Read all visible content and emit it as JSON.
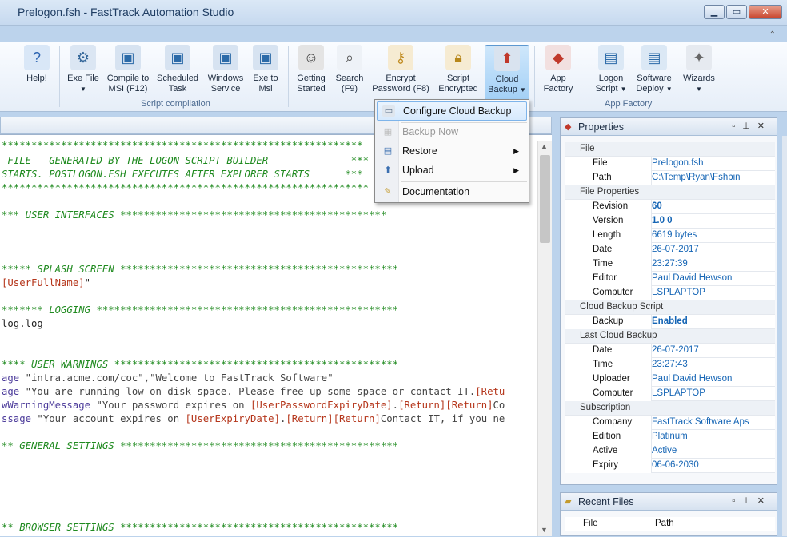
{
  "window": {
    "title": "Prelogon.fsh - FastTrack Automation Studio"
  },
  "ribbon": {
    "buttons": {
      "help": "Help!",
      "exe_file_1": "Exe File",
      "compile_msi_1": "Compile to",
      "compile_msi_2": "MSI (F12)",
      "scheduled_1": "Scheduled",
      "scheduled_2": "Task",
      "windows_1": "Windows",
      "windows_2": "Service",
      "exe_msi_1": "Exe to",
      "exe_msi_2": "Msi",
      "getting_1": "Getting",
      "getting_2": "Started",
      "search_1": "Search",
      "search_2": "(F9)",
      "encrypt_1": "Encrypt",
      "encrypt_2": "Password (F8)",
      "script_enc_1": "Script",
      "script_enc_2": "Encrypted",
      "cloud_1": "Cloud",
      "cloud_2": "Backup",
      "app_factory_1": "App",
      "app_factory_2": "Factory",
      "logon_1": "Logon",
      "logon_2": "Script",
      "software_1": "Software",
      "software_2": "Deploy",
      "wizards": "Wizards"
    },
    "groups": {
      "script_compilation": "Script compilation",
      "app_factory": "App Factory"
    }
  },
  "menu": {
    "configure": "Configure Cloud Backup",
    "backup_now": "Backup Now",
    "restore": "Restore",
    "upload": "Upload",
    "documentation": "Documentation"
  },
  "code": {
    "l1a": "*************************************************************",
    "l2": " FILE - GENERATED BY THE LOGON SCRIPT BUILDER              ***",
    "l3": "STARTS. POSTLOGON.FSH EXECUTES AFTER EXPLORER STARTS      ***",
    "l4": "**************************************************************",
    "l5": "*** USER INTERFACES *********************************************",
    "l6a": "***** SPLASH SCREEN ***********************************************",
    "l7a": "[UserFullName]",
    "l7b": "\"",
    "l8": "******* LOGGING ***************************************************",
    "l9": "log.log",
    "l10": "**** USER WARNINGS ************************************************",
    "l11a": "age ",
    "l11b": "\"intra.acme.com/coc\",\"Welcome to FastTrack Software\"",
    "l12a": "age ",
    "l12b": "\"You are running low on disk space. Please free up some space or contact IT.",
    "l12c": "[Retu",
    "l13a": "wWarningMessage ",
    "l13b": "\"Your password expires on ",
    "l13c": "[UserPasswordExpiryDate]",
    "l13d": ".",
    "l13e": "[Return][Return]",
    "l13f": "Co",
    "l14a": "ssage ",
    "l14b": "\"Your account expires on ",
    "l14c": "[UserExpiryDate]",
    "l14d": ".",
    "l14e": "[Return][Return]",
    "l14f": "Contact IT, if you ne",
    "l15": "** GENERAL SETTINGS ***********************************************",
    "l16": "** BROWSER SETTINGS ***********************************************"
  },
  "properties": {
    "title": "Properties",
    "cat_file": "File",
    "file_k": "File",
    "file_v": "Prelogon.fsh",
    "path_k": "Path",
    "path_v": "C:\\Temp\\Ryan\\Fshbin",
    "cat_fileprops": "File Properties",
    "rev_k": "Revision",
    "rev_v": "60",
    "ver_k": "Version",
    "ver_v": "1.0 0",
    "len_k": "Length",
    "len_v": "6619 bytes",
    "date_k": "Date",
    "date_v": "26-07-2017",
    "time_k": "Time",
    "time_v": "23:27:39",
    "editor_k": "Editor",
    "editor_v": "Paul David Hewson",
    "comp_k": "Computer",
    "comp_v": "LSPLAPTOP",
    "cat_cbs": "Cloud Backup Script",
    "backup_k": "Backup",
    "backup_v": "Enabled",
    "cat_lcb": "Last Cloud Backup",
    "ldate_k": "Date",
    "ldate_v": "26-07-2017",
    "ltime_k": "Time",
    "ltime_v": "23:27:43",
    "upl_k": "Uploader",
    "upl_v": "Paul David Hewson",
    "lcomp_k": "Computer",
    "lcomp_v": "LSPLAPTOP",
    "cat_sub": "Subscription",
    "company_k": "Company",
    "company_v": "FastTrack Software Aps",
    "edition_k": "Edition",
    "edition_v": "Platinum",
    "active_k": "Active",
    "active_v": "Active",
    "expiry_k": "Expiry",
    "expiry_v": "06-06-2030"
  },
  "recent": {
    "title": "Recent Files",
    "col_file": "File",
    "col_path": "Path"
  }
}
